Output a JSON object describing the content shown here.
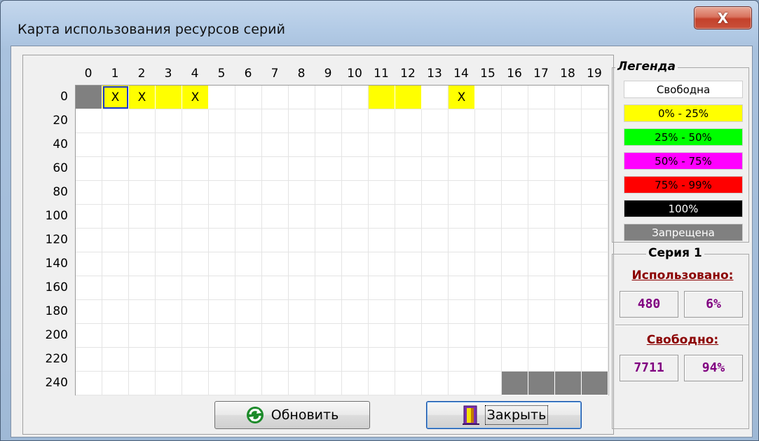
{
  "window": {
    "title": "Карта использования ресурсов серий",
    "close_glyph": "X"
  },
  "grid": {
    "columns": [
      "0",
      "1",
      "2",
      "3",
      "4",
      "5",
      "6",
      "7",
      "8",
      "9",
      "10",
      "11",
      "12",
      "13",
      "14",
      "15",
      "16",
      "17",
      "18",
      "19"
    ],
    "rows": [
      "0",
      "20",
      "40",
      "60",
      "80",
      "100",
      "120",
      "140",
      "160",
      "180",
      "200",
      "220",
      "240"
    ],
    "cells": [
      {
        "row": 0,
        "col": 0,
        "state": "forbidden",
        "mark": ""
      },
      {
        "row": 0,
        "col": 1,
        "state": "p0_25",
        "mark": "X",
        "selected": true
      },
      {
        "row": 0,
        "col": 2,
        "state": "p0_25",
        "mark": "X"
      },
      {
        "row": 0,
        "col": 3,
        "state": "p0_25",
        "mark": ""
      },
      {
        "row": 0,
        "col": 4,
        "state": "p0_25",
        "mark": "X"
      },
      {
        "row": 0,
        "col": 11,
        "state": "p0_25",
        "mark": ""
      },
      {
        "row": 0,
        "col": 12,
        "state": "p0_25",
        "mark": ""
      },
      {
        "row": 0,
        "col": 14,
        "state": "p0_25",
        "mark": "X"
      },
      {
        "row": 12,
        "col": 16,
        "state": "forbidden",
        "mark": ""
      },
      {
        "row": 12,
        "col": 17,
        "state": "forbidden",
        "mark": ""
      },
      {
        "row": 12,
        "col": 18,
        "state": "forbidden",
        "mark": ""
      },
      {
        "row": 12,
        "col": 19,
        "state": "forbidden",
        "mark": ""
      }
    ]
  },
  "legend": {
    "title": "Легенда",
    "items": [
      {
        "key": "free",
        "label": "Свободна",
        "bg": "#ffffff",
        "fg": "#000000"
      },
      {
        "key": "p0_25",
        "label": "0% - 25%",
        "bg": "#ffff00",
        "fg": "#000000"
      },
      {
        "key": "p25_50",
        "label": "25% - 50%",
        "bg": "#00ff00",
        "fg": "#000000"
      },
      {
        "key": "p50_75",
        "label": "50% - 75%",
        "bg": "#ff00ff",
        "fg": "#000000"
      },
      {
        "key": "p75_99",
        "label": "75% - 99%",
        "bg": "#ff0000",
        "fg": "#000000"
      },
      {
        "key": "full",
        "label": "100%",
        "bg": "#000000",
        "fg": "#ffffff"
      },
      {
        "key": "forbidden",
        "label": "Запрещена",
        "bg": "#808080",
        "fg": "#ffffff"
      }
    ]
  },
  "stats": {
    "title": "Серия 1",
    "used_label": "Использовано:",
    "used_count": "480",
    "used_percent": "6%",
    "free_label": "Свободно:",
    "free_count": "7711",
    "free_percent": "94%"
  },
  "buttons": {
    "refresh_label": "Обновить",
    "refresh_icon": "refresh-icon",
    "close_label": "Закрыть",
    "close_icon": "exit-door-icon"
  }
}
